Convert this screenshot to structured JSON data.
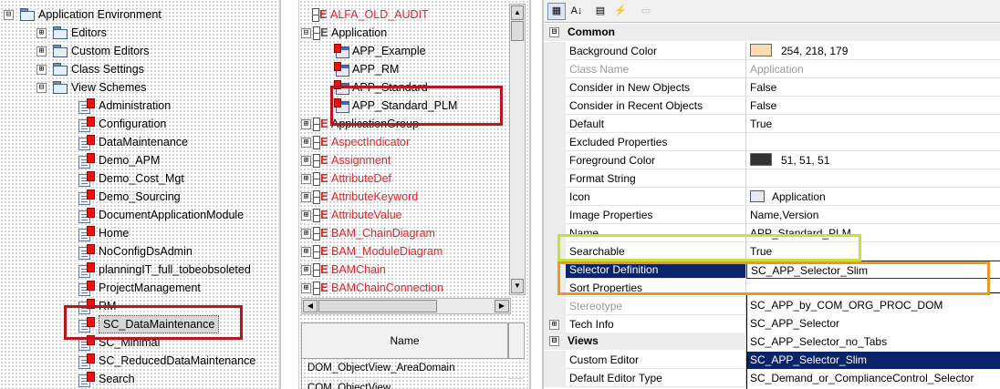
{
  "left_tree": {
    "root": {
      "label": "Application Environment",
      "expander": "⊟"
    },
    "folders": [
      {
        "label": "Editors",
        "expander": "⊞"
      },
      {
        "label": "Custom Editors",
        "expander": "⊞"
      },
      {
        "label": "Class Settings",
        "expander": "⊞"
      },
      {
        "label": "View Schemes",
        "expander": "⊟"
      }
    ],
    "schemes": [
      "Administration",
      "Configuration",
      "DataMaintenance",
      "Demo_APM",
      "Demo_Cost_Mgt",
      "Demo_Sourcing",
      "DocumentApplicationModule",
      "Home",
      "NoConfigDsAdmin",
      "planningIT_full_tobeobsoleted",
      "ProjectManagement",
      "RM",
      "SC_DataMaintenance",
      "SC_Minimal",
      "SC_ReducedDataMaintenance",
      "Search"
    ],
    "selected": "SC_DataMaintenance"
  },
  "middle": {
    "top_item": "ALFA_OLD_AUDIT",
    "application_group": "Application",
    "app_children": [
      "APP_Example",
      "APP_RM",
      "APP_Standard",
      "APP_Standard_PLM"
    ],
    "highlighted": "APP_Standard_PLM",
    "classes": [
      {
        "label": "ApplicationGroup",
        "red": false
      },
      {
        "label": "AspectIndicator",
        "red": true
      },
      {
        "label": "Assignment",
        "red": true
      },
      {
        "label": "AttributeDef",
        "red": true
      },
      {
        "label": "AttributeKeyword",
        "red": true
      },
      {
        "label": "AttributeValue",
        "red": true
      },
      {
        "label": "BAM_ChainDiagram",
        "red": true
      },
      {
        "label": "BAM_ModuleDiagram",
        "red": true
      },
      {
        "label": "BAMChain",
        "red": true
      },
      {
        "label": "BAMChainConnection",
        "red": true
      }
    ],
    "grid": {
      "header": "Name",
      "rows": [
        "DOM_ObjectView_AreaDomain",
        "COM_ObjectView"
      ]
    }
  },
  "toolbar": {
    "categorized_icon": "▦",
    "alpha_icon": "A↓",
    "props_icon": "▤",
    "events_icon": "⚡",
    "pages_icon": "▭"
  },
  "properties": {
    "cat_common": {
      "label": "Common",
      "expander": "⊟"
    },
    "rows": [
      {
        "name": "Background Color",
        "value": "254, 218, 179",
        "swatch": "#fedab3"
      },
      {
        "name": "Class Name",
        "value": "Application",
        "gray": true
      },
      {
        "name": "Consider in New Objects",
        "value": "False"
      },
      {
        "name": "Consider in Recent Objects",
        "value": "False"
      },
      {
        "name": "Default",
        "value": "True"
      },
      {
        "name": "Excluded Properties",
        "value": ""
      },
      {
        "name": "Foreground Color",
        "value": "51, 51, 51",
        "swatch": "#333333"
      },
      {
        "name": "Format String",
        "value": ""
      },
      {
        "name": "Icon",
        "value": "Application",
        "icon": true
      },
      {
        "name": "Image Properties",
        "value": "Name,Version"
      },
      {
        "name": "Name",
        "value": "APP_Standard_PLM"
      },
      {
        "name": "Searchable",
        "value": "True"
      },
      {
        "name": "Selector Definition",
        "value": "SC_APP_Selector_Slim",
        "selected": true
      },
      {
        "name": "Sort Properties",
        "value": ""
      },
      {
        "name": "Stereotype",
        "value": "",
        "gray": true
      },
      {
        "name": "Tech Info",
        "value": "",
        "expander": "⊞"
      }
    ],
    "cat_views": {
      "label": "Views",
      "expander": "⊟"
    },
    "views_rows": [
      {
        "name": "Custom Editor",
        "value": ""
      },
      {
        "name": "Default Editor Type",
        "value": ""
      }
    ]
  },
  "selector_dropdown": {
    "options": [
      "SC_APP_by_COM_ORG_PROC_DOM",
      "SC_APP_Selector",
      "SC_APP_Selector_no_Tabs",
      "SC_APP_Selector_Slim",
      "SC_Demand_or_ComplianceControl_Selector"
    ],
    "selected_index": 3
  },
  "highlight_colors": {
    "red": "#b5181f",
    "green": "#c8e03a",
    "orange": "#e69a1e"
  }
}
